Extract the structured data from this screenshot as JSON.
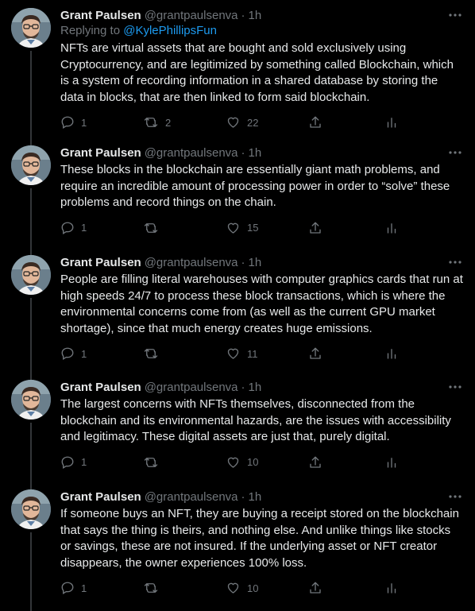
{
  "colors": {
    "background": "#000000",
    "text": "#e7e9ea",
    "muted": "#71767b",
    "link": "#1d9bf0",
    "thread_line": "#333639"
  },
  "tweets": [
    {
      "name": "Grant Paulsen",
      "handle": "@grantpaulsenva",
      "dot": "·",
      "time": "1h",
      "reply_label": "Replying to",
      "reply_to": "@KylePhillipsFun",
      "text": "NFTs are virtual assets that are bought and sold exclusively using Cryptocurrency, and are legitimized by something called Blockchain, which is a system of recording information in a shared database by storing the data in blocks, that are then linked to form said blockchain.",
      "replies": "1",
      "retweets": "2",
      "likes": "22"
    },
    {
      "name": "Grant Paulsen",
      "handle": "@grantpaulsenva",
      "dot": "·",
      "time": "1h",
      "text": "These blocks in the blockchain are essentially giant math problems, and require an incredible amount of processing power in order to “solve” these problems and record things on the chain.",
      "replies": "1",
      "retweets": "",
      "likes": "15"
    },
    {
      "name": "Grant Paulsen",
      "handle": "@grantpaulsenva",
      "dot": "·",
      "time": "1h",
      "text": "People are filling literal warehouses with computer graphics cards that run at high speeds 24/7 to process these block transactions, which is where the environmental concerns come from (as well as the current GPU market shortage), since that much energy creates huge emissions.",
      "replies": "1",
      "retweets": "",
      "likes": "11"
    },
    {
      "name": "Grant Paulsen",
      "handle": "@grantpaulsenva",
      "dot": "·",
      "time": "1h",
      "text": "The largest concerns with NFTs themselves, disconnected from the blockchain and its environmental hazards, are the issues with accessibility and legitimacy. These digital assets are just that, purely digital.",
      "replies": "1",
      "retweets": "",
      "likes": "10"
    },
    {
      "name": "Grant Paulsen",
      "handle": "@grantpaulsenva",
      "dot": "·",
      "time": "1h",
      "text": "If someone buys an NFT, they are buying a receipt stored on the blockchain that says the thing is theirs, and nothing else. And unlike things like stocks or savings, these are not insured. If the underlying asset or NFT creator disappears, the owner experiences 100% loss.",
      "replies": "1",
      "retweets": "",
      "likes": "10"
    }
  ]
}
